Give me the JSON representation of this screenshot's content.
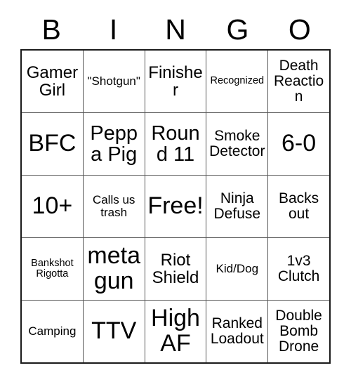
{
  "card": {
    "header_letters": [
      "B",
      "I",
      "N",
      "G",
      "O"
    ],
    "rows": [
      [
        {
          "text": "Gamer Girl",
          "size": "lg"
        },
        {
          "text": "\"Shotgun\"",
          "size": "sm"
        },
        {
          "text": "Finisher",
          "size": "lg"
        },
        {
          "text": "Recognized",
          "size": "xs"
        },
        {
          "text": "Death Reaction",
          "size": "md"
        }
      ],
      [
        {
          "text": "BFC",
          "size": "xxl"
        },
        {
          "text": "Peppa Pig",
          "size": "xl"
        },
        {
          "text": "Round 11",
          "size": "xl"
        },
        {
          "text": "Smoke Detector",
          "size": "md"
        },
        {
          "text": "6-0",
          "size": "xxl"
        }
      ],
      [
        {
          "text": "10+",
          "size": "xxl"
        },
        {
          "text": "Calls us trash",
          "size": "sm"
        },
        {
          "text": "Free!",
          "size": "xxl"
        },
        {
          "text": "Ninja Defuse",
          "size": "md"
        },
        {
          "text": "Backs out",
          "size": "md"
        }
      ],
      [
        {
          "text": "Bankshot Rigotta",
          "size": "xs"
        },
        {
          "text": "meta gun",
          "size": "xxl"
        },
        {
          "text": "Riot Shield",
          "size": "lg"
        },
        {
          "text": "Kid/Dog",
          "size": "sm"
        },
        {
          "text": "1v3 Clutch",
          "size": "md"
        }
      ],
      [
        {
          "text": "Camping",
          "size": "sm"
        },
        {
          "text": "TTV",
          "size": "xxl"
        },
        {
          "text": "High AF",
          "size": "xxl"
        },
        {
          "text": "Ranked Loadout",
          "size": "md"
        },
        {
          "text": "Double Bomb Drone",
          "size": "md"
        }
      ]
    ],
    "colors": {
      "text": "#000000",
      "outer_border": "#1a1a1a",
      "inner_border": "#555555",
      "background": "#ffffff"
    }
  }
}
